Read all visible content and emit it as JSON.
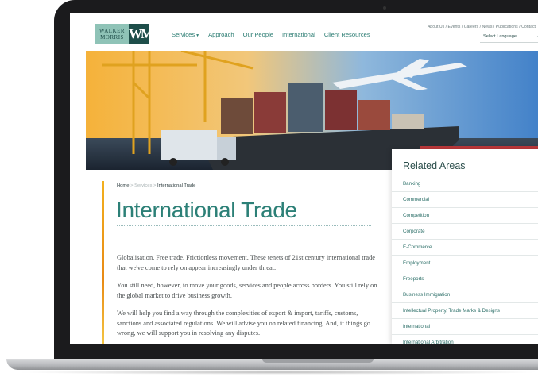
{
  "header": {
    "logo": {
      "line1": "WALKER",
      "line2": "MORRIS",
      "mark": "WM"
    },
    "nav": [
      {
        "label": "Services"
      },
      {
        "label": "Approach"
      },
      {
        "label": "Our People"
      },
      {
        "label": "International"
      },
      {
        "label": "Client Resources"
      }
    ],
    "utility": [
      "About Us",
      "Events",
      "Careers",
      "News",
      "Publications",
      "Contact"
    ],
    "language_select": {
      "label": "Select Language"
    }
  },
  "breadcrumb": {
    "home": "Home",
    "sep1": ">",
    "services": "Services",
    "sep2": ">",
    "current": "International Trade"
  },
  "page": {
    "title": "International Trade",
    "paragraphs": [
      "Globalisation. Free trade. Frictionless movement. These tenets of 21st century international trade that we've come to rely on appear increasingly under threat.",
      "You still need, however, to move your goods, services and people across borders. You still rely on the global market to drive business growth.",
      "We will help you find a way through the complexities of export & import, tariffs, customs, sanctions and associated regulations. We will advise you on related financing. And, if things go wrong, we will support you in resolving any disputes."
    ]
  },
  "related": {
    "title": "Related Areas",
    "items": [
      "Banking",
      "Commercial",
      "Competition",
      "Corporate",
      "E-Commerce",
      "Employment",
      "Freeports",
      "Business Immigration",
      "Intellectual Property, Trade Marks & Designs",
      "International",
      "International Arbitration"
    ]
  },
  "colors": {
    "brand": "#2c8077",
    "accent": "#f2b01e",
    "logo_bg": "#8fc3b7"
  }
}
